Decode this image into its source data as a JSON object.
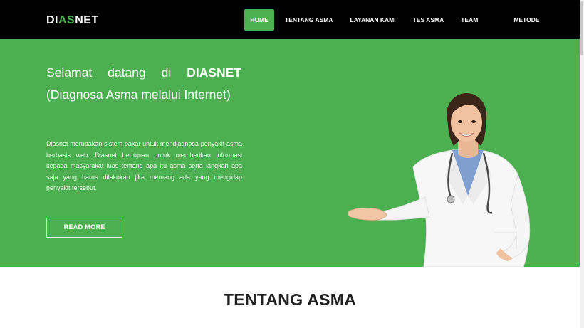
{
  "brand": {
    "part1": "DI",
    "accent": "AS",
    "part2": "NET"
  },
  "nav": [
    {
      "label": "HOME",
      "active": true
    },
    {
      "label": "TENTANG ASMA"
    },
    {
      "label": "LAYANAN KAMI"
    },
    {
      "label": "TES ASMA"
    },
    {
      "label": "TEAM"
    },
    {
      "label": "METODE"
    }
  ],
  "hero": {
    "title_pre": "Selamat datang di ",
    "title_bold": "DIASNET",
    "title_post": " (Diagnosa Asma melalui Internet)",
    "description": "Diasnet merupakan sistem pakar untuk mendiagnosa penyakit asma berbasis web. Diasnet bertujuan untuk memberikan informasi kepada masyarakat luas tentang apa itu asma serta langkah apa saja yang harus dilakukan jika memang ada yang mengidap penyakit tersebut.",
    "button_label": "READ MORE",
    "image_icon": "doctor-illustration"
  },
  "about": {
    "title": "TENTANG ASMA"
  },
  "colors": {
    "accent": "#4caf50",
    "navbar": "#000000"
  }
}
